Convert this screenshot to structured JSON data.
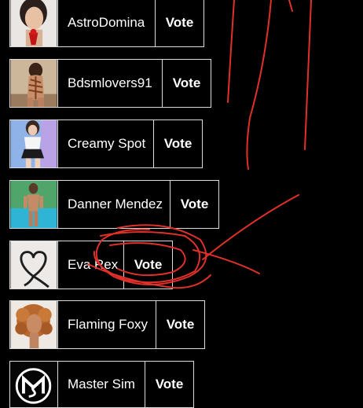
{
  "list": {
    "rows": [
      {
        "name": "AstroDomina",
        "vote_label": "Vote",
        "avatar": "portrait-red-object-avatar"
      },
      {
        "name": "Bdsmlovers91",
        "vote_label": "Vote",
        "avatar": "rope-bondage-avatar"
      },
      {
        "name": "Creamy Spot",
        "vote_label": "Vote",
        "avatar": "schoolgirl-outfit-avatar"
      },
      {
        "name": "Danner Mendez",
        "vote_label": "Vote",
        "avatar": "man-by-pool-avatar"
      },
      {
        "name": "Eva Rex",
        "vote_label": "Vote",
        "avatar": "heart-rope-avatar"
      },
      {
        "name": "Flaming Foxy",
        "vote_label": "Vote",
        "avatar": "curly-hair-woman-avatar"
      },
      {
        "name": "Master Sim",
        "vote_label": "Vote",
        "avatar": "ms-monogram-logo-avatar"
      }
    ]
  },
  "colors": {
    "background": "#000000",
    "border": "#dcdcdc",
    "text": "#ffffff",
    "annotation": "#e0302a"
  }
}
